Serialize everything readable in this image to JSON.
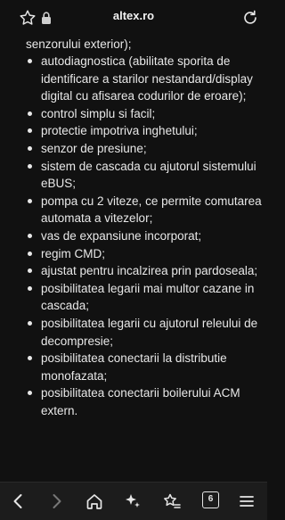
{
  "browser": {
    "domain": "altex.ro",
    "tab_count": "6"
  },
  "content": {
    "leading_text": "senzorului exterior);",
    "features": [
      "autodiagnostica (abilitate sporita de identificare a starilor nestandard/display digital cu afisarea codurilor de eroare);",
      "control simplu si facil;",
      "protectie impotriva inghetului;",
      "senzor de presiune;",
      "sistem de cascada cu ajutorul sistemului eBUS;",
      "pompa cu 2 viteze, ce permite comutarea automata a vitezelor;",
      "vas de expansiune incorporat;",
      "regim CMD;",
      "ajustat pentru incalzirea prin pardoseala;",
      "posibilitatea legarii mai multor cazane in cascada;",
      "posibilitatea legarii cu ajutorul releului de decompresie;",
      "posibilitatea conectarii la distributie monofazata;",
      "posibilitatea conectarii boilerului ACM extern."
    ]
  },
  "icons": {
    "favorite": "star-outline-icon",
    "security": "lock-icon",
    "reload": "reload-icon",
    "back": "chevron-left-icon",
    "forward": "chevron-right-icon",
    "home": "home-icon",
    "assistant": "sparkle-icon",
    "bookmarks": "star-list-icon",
    "menu": "hamburger-menu-icon"
  },
  "colors": {
    "background": "#111111",
    "text": "#e8e8e8",
    "toolbar": "#1c1c1c"
  }
}
